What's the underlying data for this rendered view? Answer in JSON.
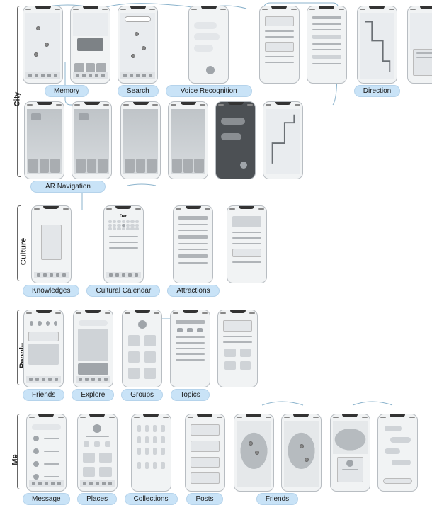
{
  "sections": {
    "city": {
      "label": "City"
    },
    "culture": {
      "label": "Culture"
    },
    "people": {
      "label": "People"
    },
    "me": {
      "label": "Me"
    }
  },
  "city_row1": {
    "memory": "Memory",
    "search": "Search",
    "voice": "Voice Recognition",
    "direction": "Direction"
  },
  "city_row2": {
    "ar_nav": "AR Navigation"
  },
  "culture_row": {
    "knowledges": "Knowledges",
    "calendar": "Cultural Calendar",
    "attractions": "Attractions"
  },
  "people_row": {
    "friends": "Friends",
    "explore": "Explore",
    "groups": "Groups",
    "topics": "Topics"
  },
  "me_row": {
    "message": "Message",
    "places": "Places",
    "collections": "Collections",
    "posts": "Posts",
    "friends": "Friends"
  },
  "calendar_sample": {
    "month": "Dec"
  }
}
